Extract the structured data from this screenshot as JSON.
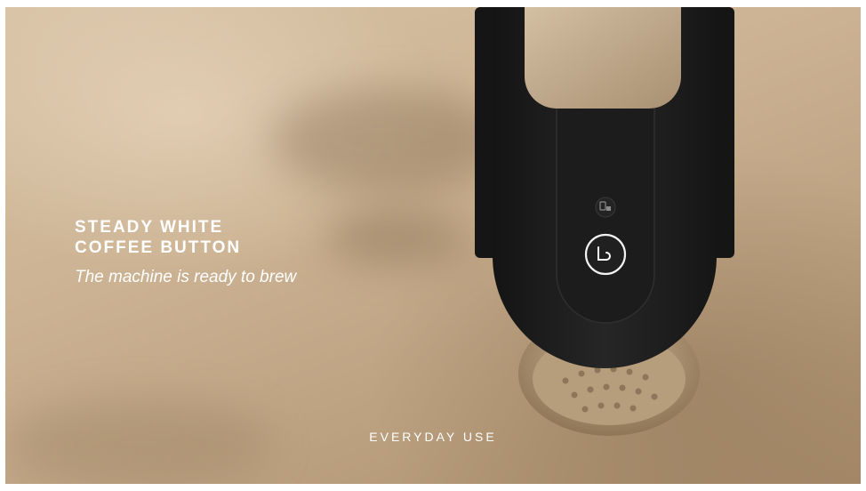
{
  "headline": {
    "line1": "STEADY WHITE",
    "line2": "COFFEE BUTTON"
  },
  "subheadline": "The machine is ready to brew",
  "footer_label": "EVERYDAY USE",
  "icons": {
    "coffee_button": "coffee-cup-icon",
    "status_light": "milk-frother-icon"
  },
  "colors": {
    "background": "#cbb292",
    "machine_body": "#1e1e1e",
    "accent_metal": "#bfa889",
    "text": "#ffffff"
  }
}
